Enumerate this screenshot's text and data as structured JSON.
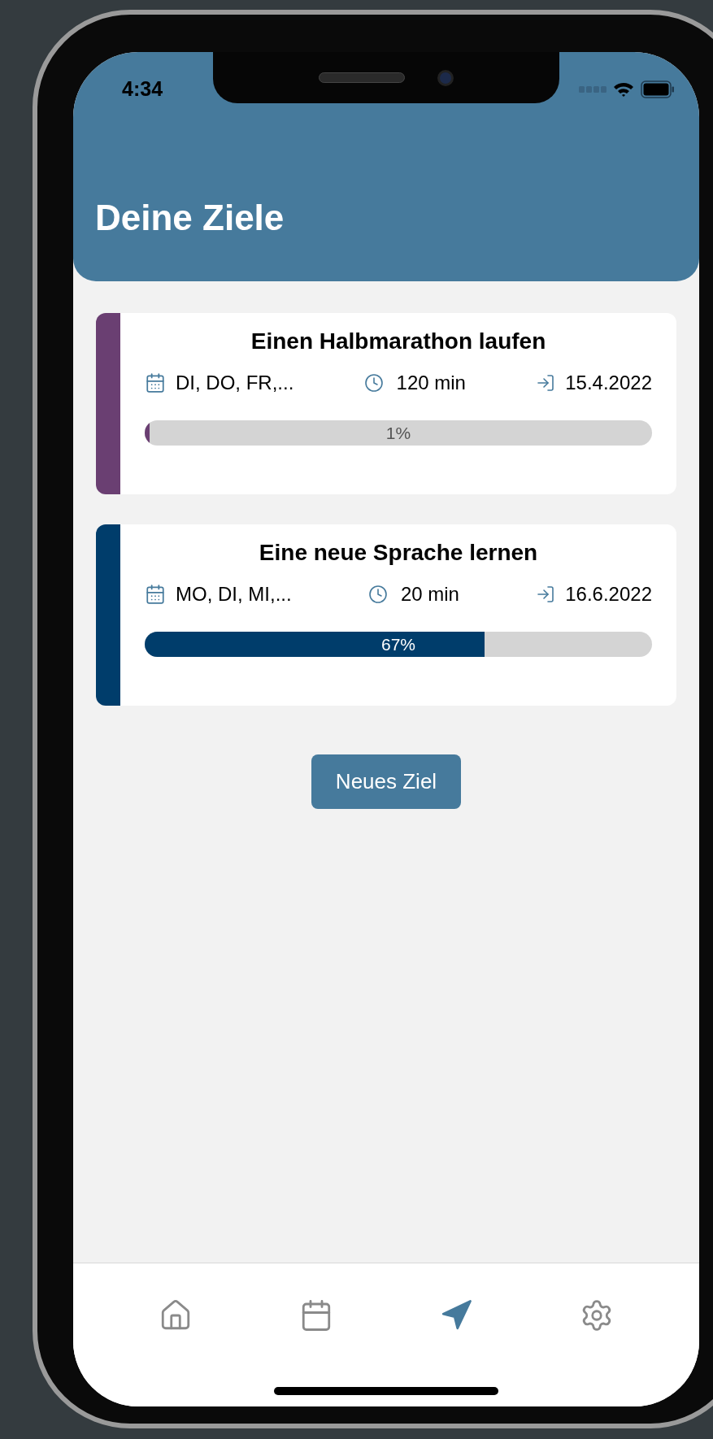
{
  "status_bar": {
    "time": "4:34"
  },
  "header": {
    "title": "Deine Ziele"
  },
  "goals": [
    {
      "title": "Einen Halbmarathon laufen",
      "days": "DI, DO, FR,...",
      "duration": "120 min",
      "date": "15.4.2022",
      "level": 0.01,
      "progress_text": "1%",
      "color": "#6a3f72"
    },
    {
      "title": "Eine neue Sprache lernen",
      "days": "MO, DI, MI,...",
      "duration": "20 min",
      "date": "16.6.2022",
      "level": 0.67,
      "progress_text": "67%",
      "color": "#003d6b"
    }
  ],
  "new_goal_button": "Neues Ziel",
  "tab_bar": [
    {
      "kind": "home",
      "selected": false
    },
    {
      "kind": "calendar",
      "selected": false
    },
    {
      "kind": "navigate",
      "selected": true
    },
    {
      "kind": "settings",
      "selected": false
    }
  ]
}
